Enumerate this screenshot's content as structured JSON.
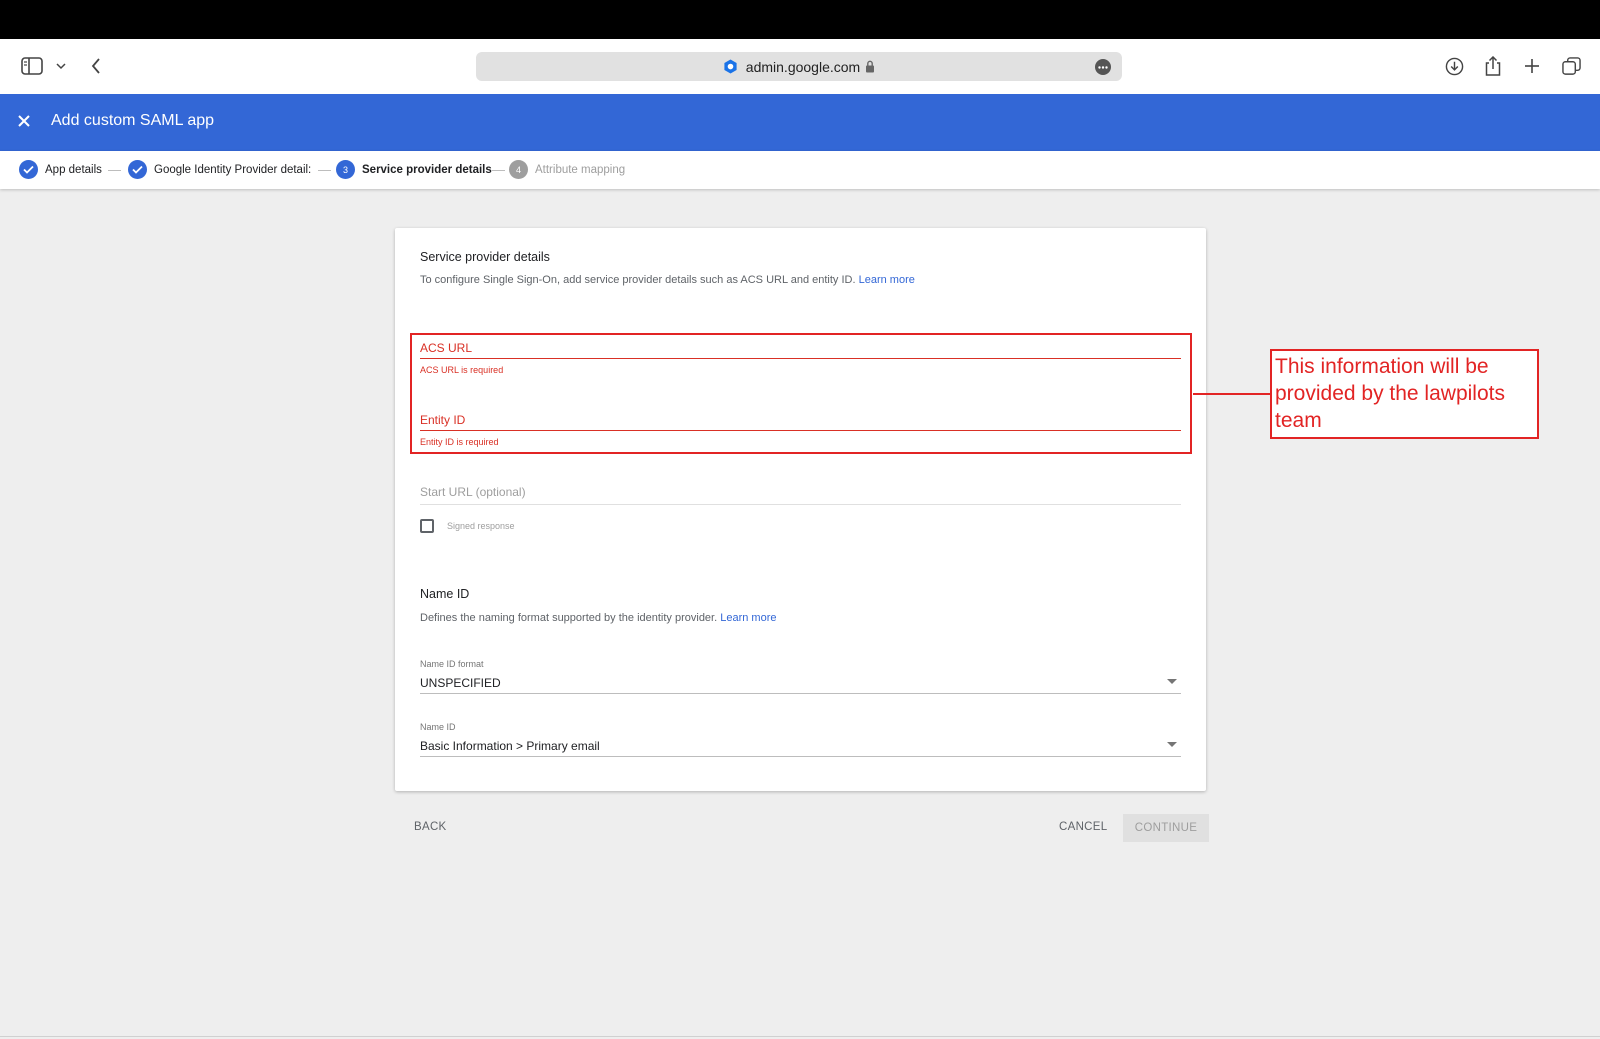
{
  "browser": {
    "url": "admin.google.com"
  },
  "header": {
    "title": "Add custom SAML app"
  },
  "stepper": {
    "steps": [
      {
        "label": "App details",
        "state": "done",
        "number": "1"
      },
      {
        "label": "Google Identity Provider detail:",
        "state": "done",
        "number": "2"
      },
      {
        "label": "Service provider details",
        "state": "active",
        "number": "3"
      },
      {
        "label": "Attribute mapping",
        "state": "disabled",
        "number": "4"
      }
    ]
  },
  "service_provider": {
    "title": "Service provider details",
    "description": "To configure Single Sign-On, add service provider details such as ACS URL and entity ID.",
    "learn_more": "Learn more",
    "acs_url": {
      "label": "ACS URL",
      "error": "ACS URL is required"
    },
    "entity_id": {
      "label": "Entity ID",
      "error": "Entity ID is required"
    },
    "start_url": {
      "label": "Start URL (optional)"
    },
    "signed_response": {
      "label": "Signed response",
      "checked": false
    }
  },
  "name_id": {
    "title": "Name ID",
    "description": "Defines the naming format supported by the identity provider.",
    "learn_more": "Learn more",
    "format": {
      "label": "Name ID format",
      "value": "UNSPECIFIED"
    },
    "name_id": {
      "label": "Name ID",
      "value": "Basic Information > Primary email"
    }
  },
  "actions": {
    "back": "BACK",
    "cancel": "CANCEL",
    "continue": "CONTINUE"
  },
  "annotation": {
    "text": "This information will be provided by the lawpilots team",
    "color": "#e22424"
  },
  "colors": {
    "brand": "#3367d6",
    "error": "#d93025"
  }
}
